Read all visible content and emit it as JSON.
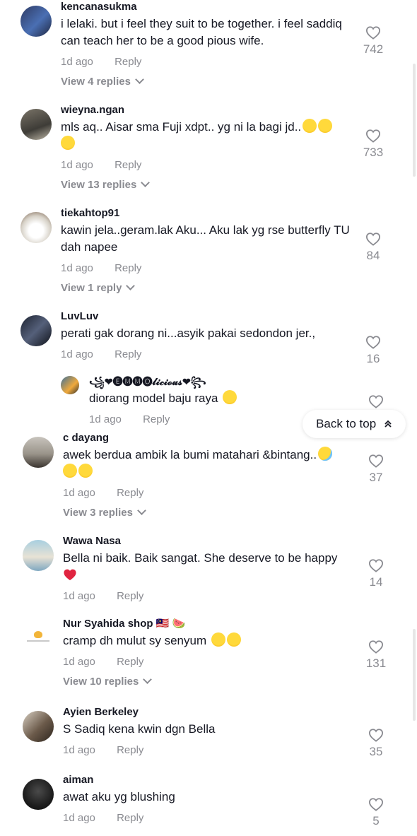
{
  "back_to_top": {
    "label": "Back to top",
    "icon": "double-chevron-up-icon"
  },
  "comments": [
    {
      "username": "kencanasukma",
      "text": "i lelaki. but i feel they suit to be together. i feel saddiq can teach her to be a good pious wife.",
      "time": "1d ago",
      "reply": "Reply",
      "view_replies": "View 4 replies",
      "likes": "742"
    },
    {
      "username": "wieyna.ngan",
      "text": "mls aq.. Aisar sma Fuji xdpt.. yg ni la bagi jd..",
      "time": "1d ago",
      "reply": "Reply",
      "view_replies": "View 13 replies",
      "likes": "733"
    },
    {
      "username": "tiekahtop91",
      "text": "kawin jela..geram.lak Aku... Aku lak yg rse butterfly TU dah napee",
      "time": "1d ago",
      "reply": "Reply",
      "view_replies": "View 1 reply",
      "likes": "84"
    },
    {
      "username": "LuvLuv",
      "text": "perati gak dorang ni...asyik pakai sedondon jer.,",
      "time": "1d ago",
      "reply": "Reply",
      "likes": "16",
      "child": {
        "username": "꧁❤🅔🅜🅜🅞𝓵𝓲𝓬𝓲𝓸𝓾𝓼❤꧂",
        "text": "diorang model baju raya",
        "time": "1d ago",
        "reply": "Reply"
      }
    },
    {
      "username": "c dayang",
      "text": "awek berdua ambik la bumi matahari &bintang..",
      "time": "1d ago",
      "reply": "Reply",
      "view_replies": "View 3 replies",
      "likes": "37"
    },
    {
      "username": "Wawa Nasa",
      "text": "Bella ni baik. Baik sangat. She deserve to be happy",
      "time": "1d ago",
      "reply": "Reply",
      "likes": "14"
    },
    {
      "username": "Nur Syahida shop 🇲🇾 🍉",
      "text": "cramp dh mulut sy senyum",
      "time": "1d ago",
      "reply": "Reply",
      "view_replies": "View 10 replies",
      "likes": "131"
    },
    {
      "username": "Ayien Berkeley",
      "text": "S Sadiq kena kwin dgn Bella",
      "time": "1d ago",
      "reply": "Reply",
      "likes": "35"
    },
    {
      "username": "aiman",
      "text": "awat aku yg blushing",
      "time": "1d ago",
      "reply": "Reply",
      "likes": "5"
    }
  ],
  "colors": {
    "text": "#161823",
    "muted": "#8a8b91",
    "like_heart": "#8a8b91"
  }
}
